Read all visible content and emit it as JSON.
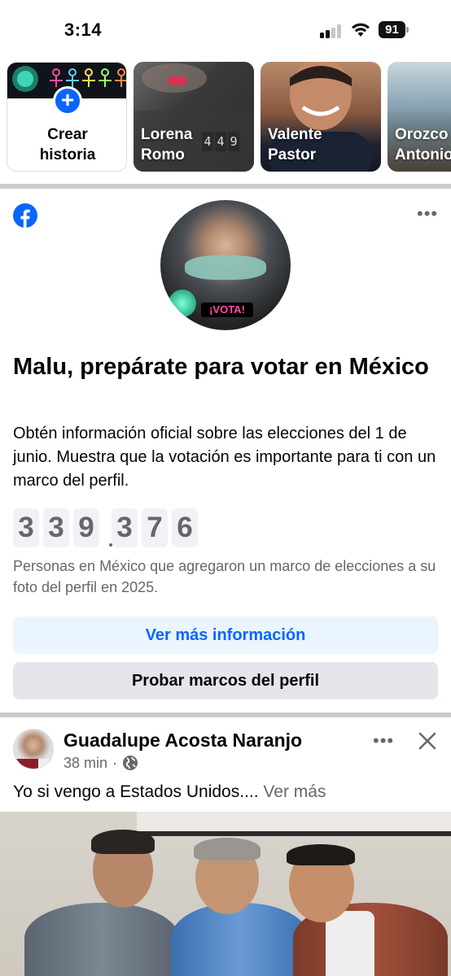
{
  "status_bar": {
    "time": "3:14",
    "battery": "91"
  },
  "stories": {
    "create": {
      "line1": "Crear",
      "line2": "historia"
    },
    "items": [
      {
        "line1": "Lorena",
        "line2": "Romo",
        "counter": [
          "4",
          "4",
          "9"
        ]
      },
      {
        "line1": "Valente",
        "line2": "Pastor"
      },
      {
        "line1": "Orozco",
        "line2": "Antonio"
      }
    ]
  },
  "election_card": {
    "badge_text": "¡VOTA!",
    "title": "Malu, prepárate para votar en México",
    "description": "Obtén información oficial sobre las elecciones del 1 de junio. Muestra que la votación es importante para ti con un marco del perfil.",
    "counter_digits": [
      "3",
      "3",
      "9",
      "3",
      "7",
      "6"
    ],
    "note": "Personas en México que agregaron un marco de elecciones a su foto del perfil en 2025.",
    "primary_button": "Ver más información",
    "secondary_button": "Probar marcos del perfil",
    "colors": {
      "accent": "#0866ff",
      "primary_bg": "#ebf5ff",
      "secondary_bg": "#e4e6eb",
      "muted_text": "#65676b"
    }
  },
  "post": {
    "author": "Guadalupe Acosta Naranjo",
    "time": "38 min",
    "dot": "·",
    "text": "Yo si vengo a Estados Unidos....",
    "see_more": "Ver más",
    "icons": [
      "globe-icon",
      "more-icon",
      "close-icon"
    ]
  }
}
